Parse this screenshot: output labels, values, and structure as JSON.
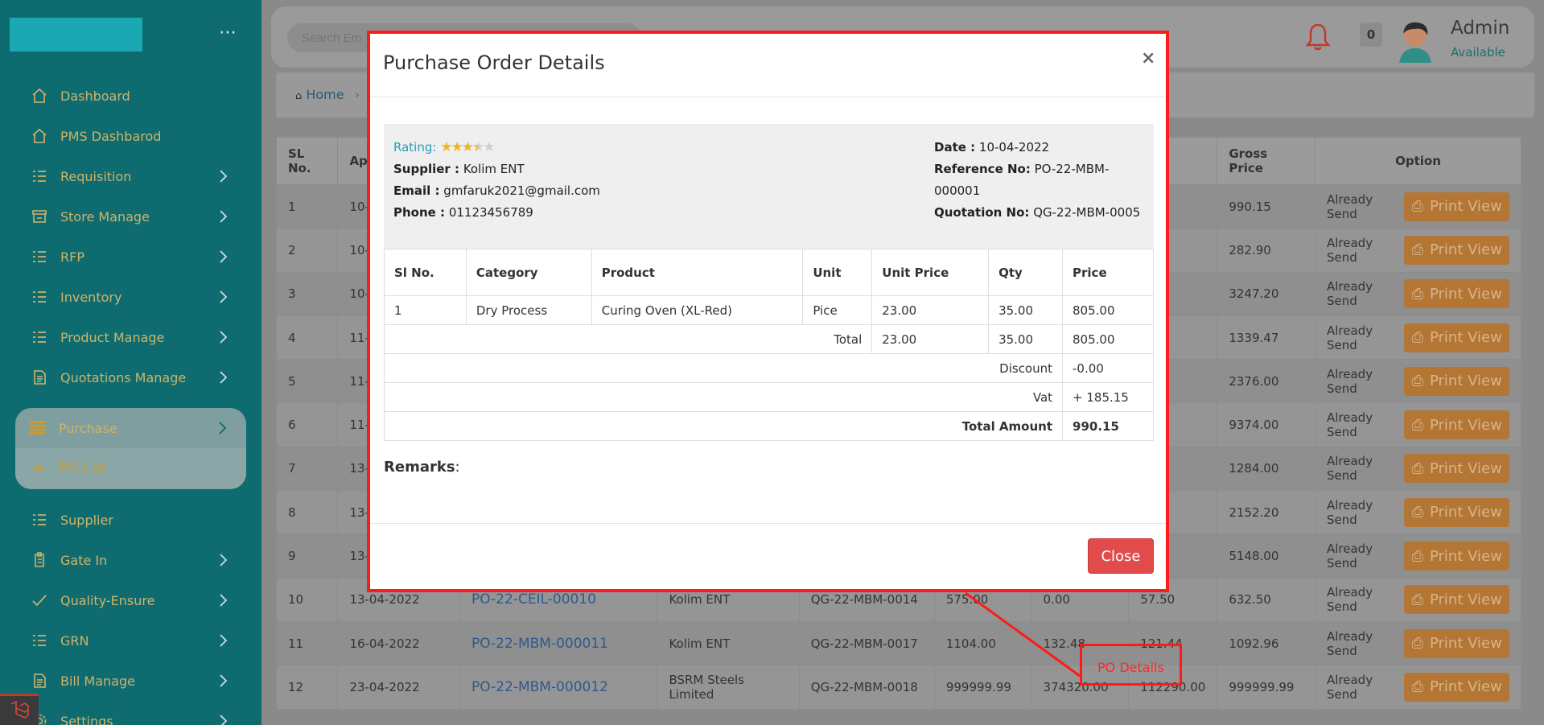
{
  "sidebar": {
    "menu_icon": "ellipsis-icon",
    "items": [
      {
        "label": "Dashboard",
        "icon": "home-icon"
      },
      {
        "label": "PMS Dashbarod",
        "icon": "home-icon"
      },
      {
        "label": "Requisition",
        "icon": "list-icon"
      },
      {
        "label": "Store Manage",
        "icon": "store-icon"
      },
      {
        "label": "RFP",
        "icon": "list-icon"
      },
      {
        "label": "Inventory",
        "icon": "list-icon"
      },
      {
        "label": "Product Manage",
        "icon": "list-icon"
      },
      {
        "label": "Quotations Manage",
        "icon": "document-icon"
      }
    ],
    "active_group": {
      "label": "Purchase",
      "icon": "list-icon",
      "sub_label": "PO List",
      "sub_icon": "arrow-right-icon"
    },
    "bottom_items": [
      {
        "label": "Supplier",
        "icon": "list-icon"
      },
      {
        "label": "Gate In",
        "icon": "clipboard-icon"
      },
      {
        "label": "Quality-Ensure",
        "icon": "check-icon"
      },
      {
        "label": "GRN",
        "icon": "list-icon"
      },
      {
        "label": "Bill Manage",
        "icon": "document-icon"
      },
      {
        "label": "Settings",
        "icon": "gear-icon"
      }
    ]
  },
  "header": {
    "search_placeholder": "Search Em",
    "notification_count": "0",
    "user_name": "Admin",
    "user_status": "Available"
  },
  "breadcrumb": {
    "home": "Home"
  },
  "table": {
    "headers": [
      "SL No.",
      "Ap",
      "",
      "",
      "",
      "",
      "",
      "",
      "Gross Price",
      "Option"
    ],
    "rows": [
      {
        "sl": "1",
        "date": "10-",
        "po": "",
        "supplier": "",
        "quotation": "",
        "c6": "",
        "c7": "",
        "c8": "",
        "gross": "990.15",
        "status": "Already Send"
      },
      {
        "sl": "2",
        "date": "10-",
        "po": "",
        "supplier": "",
        "quotation": "",
        "c6": "",
        "c7": "",
        "c8": "",
        "gross": "282.90",
        "status": "Already Send"
      },
      {
        "sl": "3",
        "date": "10-",
        "po": "",
        "supplier": "",
        "quotation": "",
        "c6": "",
        "c7": "",
        "c8": "",
        "gross": "3247.20",
        "status": "Already Send"
      },
      {
        "sl": "4",
        "date": "11-",
        "po": "",
        "supplier": "",
        "quotation": "",
        "c6": "",
        "c7": "",
        "c8": "",
        "gross": "1339.47",
        "status": "Already Send"
      },
      {
        "sl": "5",
        "date": "11-",
        "po": "",
        "supplier": "",
        "quotation": "",
        "c6": "",
        "c7": "",
        "c8": "",
        "gross": "2376.00",
        "status": "Already Send"
      },
      {
        "sl": "6",
        "date": "11-",
        "po": "",
        "supplier": "",
        "quotation": "",
        "c6": "",
        "c7": "",
        "c8": "",
        "gross": "9374.00",
        "status": "Already Send"
      },
      {
        "sl": "7",
        "date": "13-",
        "po": "",
        "supplier": "",
        "quotation": "",
        "c6": "",
        "c7": "",
        "c8": "",
        "gross": "1284.00",
        "status": "Already Send"
      },
      {
        "sl": "8",
        "date": "13-",
        "po": "",
        "supplier": "",
        "quotation": "",
        "c6": "",
        "c7": "",
        "c8": "",
        "gross": "2152.20",
        "status": "Already Send"
      },
      {
        "sl": "9",
        "date": "13-",
        "po": "",
        "supplier": "",
        "quotation": "",
        "c6": "",
        "c7": "",
        "c8": "",
        "gross": "5148.00",
        "status": "Already Send"
      },
      {
        "sl": "10",
        "date": "13-04-2022",
        "po": "PO-22-CEIL-00010",
        "supplier": "Kolim ENT",
        "quotation": "QG-22-MBM-0014",
        "c6": "575.00",
        "c7": "0.00",
        "c8": "57.50",
        "gross": "632.50",
        "status": "Already Send"
      },
      {
        "sl": "11",
        "date": "16-04-2022",
        "po": "PO-22-MBM-000011",
        "supplier": "Kolim ENT",
        "quotation": "QG-22-MBM-0017",
        "c6": "1104.00",
        "c7": "132.48",
        "c8": "121.44",
        "gross": "1092.96",
        "status": "Already Send"
      },
      {
        "sl": "12",
        "date": "23-04-2022",
        "po": "PO-22-MBM-000012",
        "supplier": "BSRM Steels Limited",
        "quotation": "QG-22-MBM-0018",
        "c6": "999999.99",
        "c7": "374320.00",
        "c8": "112290.00",
        "gross": "999999.99",
        "status": "Already Send"
      }
    ],
    "print_label": "Print View"
  },
  "modal": {
    "title": "Purchase Order Details",
    "close_x": "×",
    "rating_label": "Rating:",
    "rating_value": 3.5,
    "rating_max": 5,
    "supplier_label": "Supplier :",
    "supplier": "Kolim ENT",
    "email_label": "Email :",
    "email": "gmfaruk2021@gmail.com",
    "phone_label": "Phone :",
    "phone": "01123456789",
    "date_label": "Date :",
    "date": "10-04-2022",
    "ref_label": "Reference No:",
    "ref": "PO-22-MBM-000001",
    "quot_label": "Quotation No:",
    "quot": "QG-22-MBM-0005",
    "columns": [
      "Sl No.",
      "Category",
      "Product",
      "Unit",
      "Unit Price",
      "Qty",
      "Price"
    ],
    "items": [
      {
        "sl": "1",
        "category": "Dry Process",
        "product": "Curing Oven (XL-Red)",
        "unit": "Pice",
        "unit_price": "23.00",
        "qty": "35.00",
        "price": "805.00"
      }
    ],
    "total_label": "Total",
    "total_unit_price": "23.00",
    "total_qty": "35.00",
    "total_price": "805.00",
    "discount_label": "Discount",
    "discount": "-0.00",
    "vat_label": "Vat",
    "vat": "+ 185.15",
    "total_amount_label": "Total Amount",
    "total_amount": "990.15",
    "remarks_label": "Remarks",
    "remarks_colon": ":",
    "close_button": "Close"
  },
  "annotation": {
    "label": "PO Details"
  },
  "colors": {
    "sidebar": "#0e6b70",
    "accent": "#cfb46a",
    "danger": "#e14b4b",
    "highlight": "#ff1a1a"
  }
}
